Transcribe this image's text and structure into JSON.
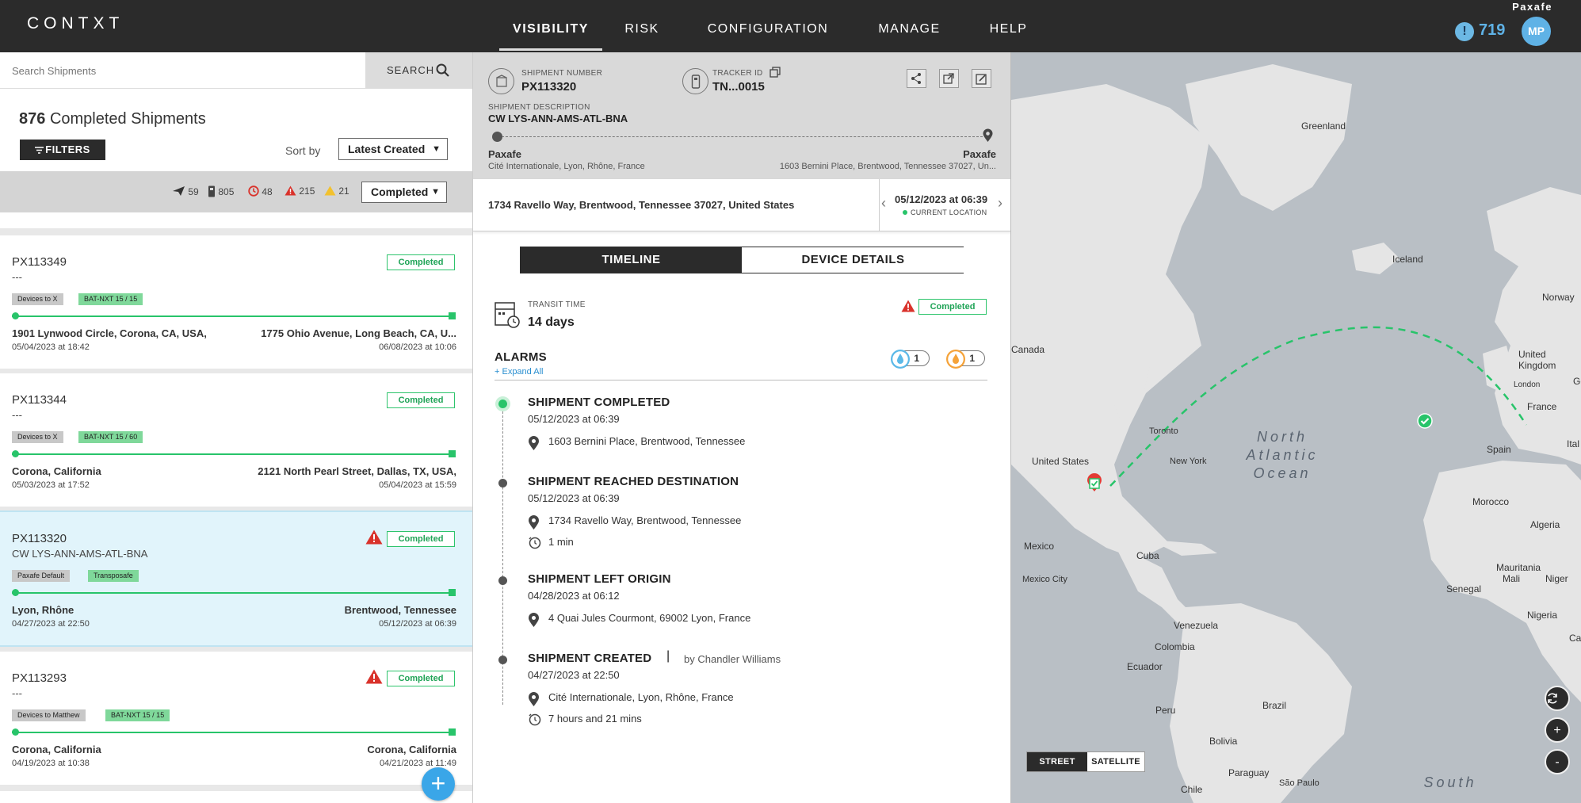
{
  "topbar": {
    "logo": "CONTXT",
    "nav": [
      {
        "label": "VISIBILITY"
      },
      {
        "label": "RISK"
      },
      {
        "label": "CONFIGURATION"
      },
      {
        "label": "MANAGE"
      },
      {
        "label": "HELP"
      }
    ],
    "org_name": "Paxafe",
    "alert_icon": "!",
    "alert_count": "719",
    "avatar_initials": "MP"
  },
  "left": {
    "search_placeholder": "Search Shipments",
    "search_label": "SEARCH",
    "count": "876",
    "count_label": "Completed Shipments",
    "filters_label": "FILTERS",
    "sort_by_label": "Sort by",
    "sort_value": "Latest Created",
    "stats": [
      {
        "icon": "plane-icon",
        "value": "59"
      },
      {
        "icon": "tracker-icon",
        "value": "805"
      },
      {
        "icon": "clock-alert-icon",
        "value": "48"
      },
      {
        "icon": "red-warning-icon",
        "value": "215"
      },
      {
        "icon": "yellow-warning-icon",
        "value": "21"
      }
    ],
    "status_filter": "Completed",
    "shipments": [
      {
        "id": "PX113349",
        "description": "---",
        "status": "Completed",
        "has_alert": false,
        "tags": [
          "Devices to X",
          "BAT-NXT 15 / 15"
        ],
        "from": "1901 Lynwood Circle, Corona, CA, USA,",
        "from_date": "05/04/2023 at 18:42",
        "to": "1775 Ohio Avenue, Long Beach, CA, U...",
        "to_date": "06/08/2023 at 10:06"
      },
      {
        "id": "PX113344",
        "description": "---",
        "status": "Completed",
        "has_alert": false,
        "tags": [
          "Devices to X",
          "BAT-NXT 15 / 60"
        ],
        "from": "Corona, California",
        "from_date": "05/03/2023 at 17:52",
        "to": "2121 North Pearl Street, Dallas, TX, USA,",
        "to_date": "05/04/2023 at 15:59"
      },
      {
        "id": "PX113320",
        "description": "CW LYS-ANN-AMS-ATL-BNA",
        "status": "Completed",
        "has_alert": true,
        "tags": [
          "Paxafe Default",
          "Transposafe"
        ],
        "from": "Lyon, Rhône",
        "from_date": "04/27/2023 at 22:50",
        "to": "Brentwood, Tennessee",
        "to_date": "05/12/2023 at 06:39"
      },
      {
        "id": "PX113293",
        "description": "---",
        "status": "Completed",
        "has_alert": true,
        "tags": [
          "Devices to Matthew",
          "BAT-NXT 15 / 15"
        ],
        "from": "Corona, California",
        "from_date": "04/19/2023 at 10:38",
        "to": "Corona, California",
        "to_date": "04/21/2023 at 11:49"
      }
    ],
    "add_button": "+"
  },
  "detail": {
    "shipment_number_label": "SHIPMENT NUMBER",
    "shipment_number": "PX113320",
    "tracker_id_label": "TRACKER ID",
    "tracker_id": "TN...0015",
    "description_label": "SHIPMENT DESCRIPTION",
    "description": "CW LYS-ANN-AMS-ATL-BNA",
    "origin_name": "Paxafe",
    "origin_address": "Cité Internationale, Lyon, Rhône, France",
    "destination_name": "Paxafe",
    "destination_address": "1603 Bernini Place, Brentwood, Tennessee 37027, Un...",
    "current_address": "1734 Ravello Way, Brentwood, Tennessee 37027, United States",
    "current_date": "05/12/2023 at 06:39",
    "current_location_label": "CURRENT LOCATION",
    "tabs": [
      "TIMELINE",
      "DEVICE DETAILS"
    ],
    "transit_time_label": "TRANSIT TIME",
    "transit_time": "14 days",
    "status": "Completed",
    "alarms_label": "ALARMS",
    "expand_all": "+ Expand All",
    "alarm_counts": [
      {
        "icon": "humidity-icon",
        "value": "1",
        "color": "#5bb9e8"
      },
      {
        "icon": "temperature-icon",
        "value": "1",
        "color": "#f5a33a"
      }
    ],
    "events": [
      {
        "title": "SHIPMENT COMPLETED",
        "date": "05/12/2023 at 06:39",
        "location": "1603 Bernini Place, Brentwood, Tennessee",
        "duration": ""
      },
      {
        "title": "SHIPMENT REACHED DESTINATION",
        "date": "05/12/2023 at 06:39",
        "location": "1734 Ravello Way, Brentwood, Tennessee",
        "duration": "1 min"
      },
      {
        "title": "SHIPMENT LEFT ORIGIN",
        "date": "04/28/2023 at 06:12",
        "location": "4 Quai Jules Courmont, 69002 Lyon, France",
        "duration": ""
      },
      {
        "title": "SHIPMENT CREATED",
        "by": "by Chandler Williams",
        "date": "04/27/2023 at 22:50",
        "location": "Cité Internationale, Lyon, Rhône, France",
        "duration": "7 hours and 21 mins"
      }
    ]
  },
  "map": {
    "labels": [
      "Greenland",
      "Iceland",
      "Norway",
      "Canada",
      "United Kingdom",
      "London",
      "Germany",
      "France",
      "Spain",
      "Ital",
      "Toronto",
      "New York",
      "United States",
      "Morocco",
      "Algeria",
      "Mexico",
      "Mexico City",
      "Cuba",
      "Mauritania",
      "Mali",
      "Niger",
      "Senegal",
      "Nigeria",
      "Camer",
      "Venezuela",
      "Colombia",
      "Ecuador",
      "Peru",
      "Brazil",
      "Bolivia",
      "Paraguay",
      "São Paulo",
      "Chile"
    ],
    "ocean_north": "North\nAtlantic\nOcean",
    "ocean_south": "South",
    "map_types": [
      "STREET",
      "SATELLITE"
    ],
    "zoom_in": "+",
    "zoom_out": "-",
    "route_color": "#28c46a"
  }
}
